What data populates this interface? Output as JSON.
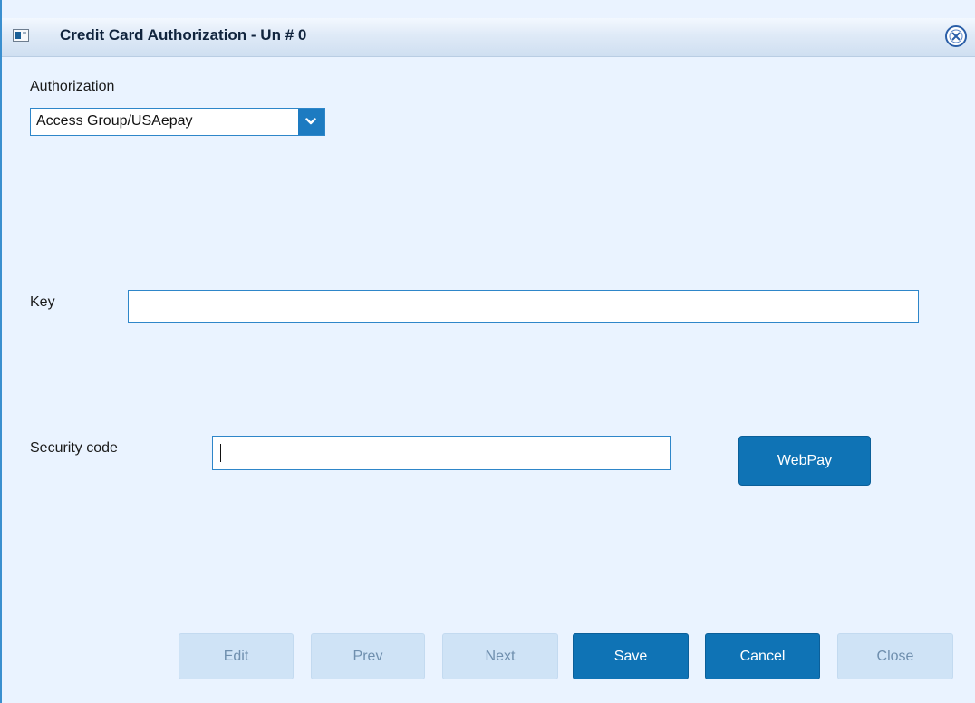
{
  "window": {
    "title": "Credit Card Authorization - Un # 0",
    "icon": "app-window-icon",
    "close_icon": "close-circle-icon"
  },
  "authorization": {
    "label": "Authorization",
    "selected": "Access Group/USAepay",
    "arrow_icon": "chevron-down-icon"
  },
  "key": {
    "label": "Key",
    "value": ""
  },
  "security_code": {
    "label": "Security code",
    "value": ""
  },
  "webpay_button": "WebPay",
  "footer": {
    "edit": "Edit",
    "prev": "Prev",
    "next": "Next",
    "save": "Save",
    "cancel": "Cancel",
    "close": "Close"
  },
  "colors": {
    "accent": "#0f73b5",
    "background": "#eaf3ff",
    "disabled_button": "#cfe3f6"
  }
}
